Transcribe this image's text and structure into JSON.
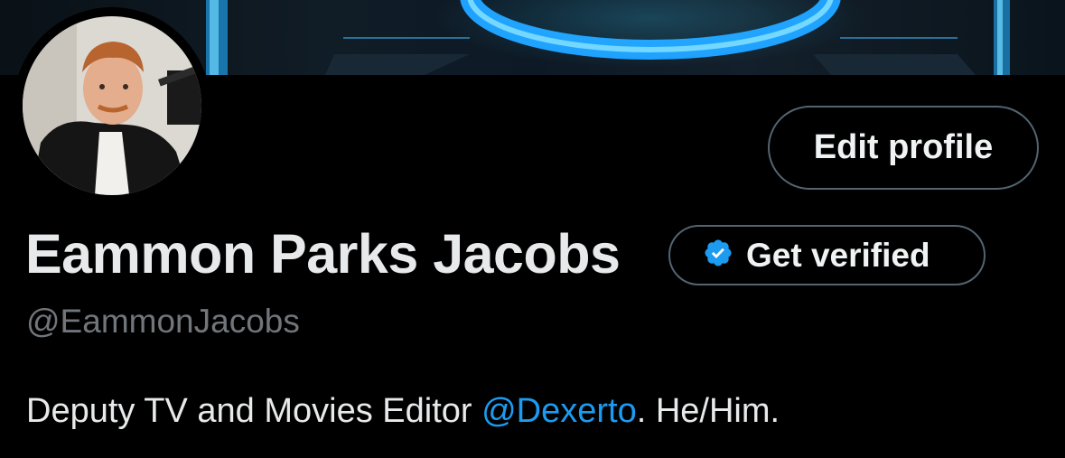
{
  "profile": {
    "display_name": "Eammon Parks Jacobs",
    "handle": "@EammonJacobs",
    "bio": {
      "prefix": "Deputy TV and Movies Editor ",
      "mention": "@Dexerto",
      "suffix": ". He/Him."
    }
  },
  "actions": {
    "edit_profile_label": "Edit profile",
    "get_verified_label": "Get verified"
  },
  "colors": {
    "background": "#000000",
    "text_primary": "#e7e9ea",
    "text_secondary": "#71767b",
    "accent": "#1d9bf0",
    "button_border": "#536471"
  },
  "icons": {
    "verified": "verified-badge-icon"
  }
}
